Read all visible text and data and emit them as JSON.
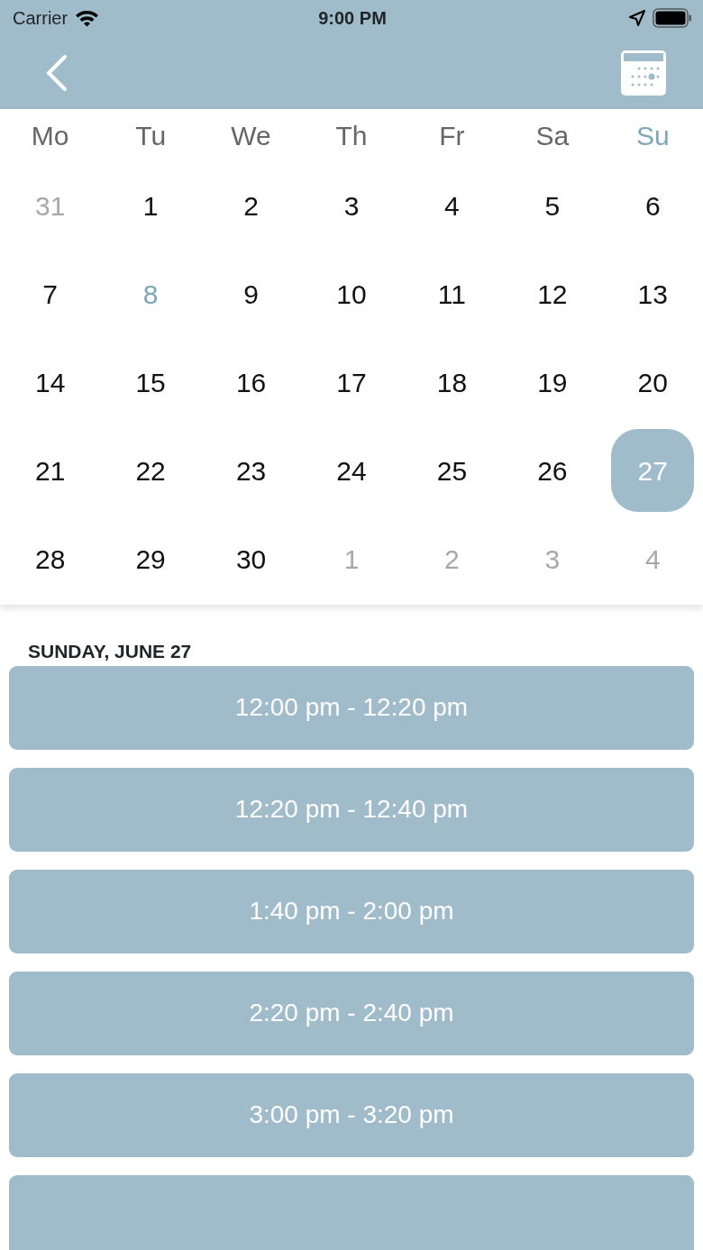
{
  "status_bar": {
    "carrier": "Carrier",
    "time": "9:00 PM"
  },
  "weekdays": [
    {
      "label": "Mo",
      "highlighted": false
    },
    {
      "label": "Tu",
      "highlighted": false
    },
    {
      "label": "We",
      "highlighted": false
    },
    {
      "label": "Th",
      "highlighted": false
    },
    {
      "label": "Fr",
      "highlighted": false
    },
    {
      "label": "Sa",
      "highlighted": false
    },
    {
      "label": "Su",
      "highlighted": true
    }
  ],
  "weeks": [
    [
      {
        "day": "31",
        "muted": true,
        "today": false,
        "selected": false
      },
      {
        "day": "1",
        "muted": false,
        "today": false,
        "selected": false
      },
      {
        "day": "2",
        "muted": false,
        "today": false,
        "selected": false
      },
      {
        "day": "3",
        "muted": false,
        "today": false,
        "selected": false
      },
      {
        "day": "4",
        "muted": false,
        "today": false,
        "selected": false
      },
      {
        "day": "5",
        "muted": false,
        "today": false,
        "selected": false
      },
      {
        "day": "6",
        "muted": false,
        "today": false,
        "selected": false
      }
    ],
    [
      {
        "day": "7",
        "muted": false,
        "today": false,
        "selected": false
      },
      {
        "day": "8",
        "muted": false,
        "today": true,
        "selected": false
      },
      {
        "day": "9",
        "muted": false,
        "today": false,
        "selected": false
      },
      {
        "day": "10",
        "muted": false,
        "today": false,
        "selected": false
      },
      {
        "day": "11",
        "muted": false,
        "today": false,
        "selected": false
      },
      {
        "day": "12",
        "muted": false,
        "today": false,
        "selected": false
      },
      {
        "day": "13",
        "muted": false,
        "today": false,
        "selected": false
      }
    ],
    [
      {
        "day": "14",
        "muted": false,
        "today": false,
        "selected": false
      },
      {
        "day": "15",
        "muted": false,
        "today": false,
        "selected": false
      },
      {
        "day": "16",
        "muted": false,
        "today": false,
        "selected": false
      },
      {
        "day": "17",
        "muted": false,
        "today": false,
        "selected": false
      },
      {
        "day": "18",
        "muted": false,
        "today": false,
        "selected": false
      },
      {
        "day": "19",
        "muted": false,
        "today": false,
        "selected": false
      },
      {
        "day": "20",
        "muted": false,
        "today": false,
        "selected": false
      }
    ],
    [
      {
        "day": "21",
        "muted": false,
        "today": false,
        "selected": false
      },
      {
        "day": "22",
        "muted": false,
        "today": false,
        "selected": false
      },
      {
        "day": "23",
        "muted": false,
        "today": false,
        "selected": false
      },
      {
        "day": "24",
        "muted": false,
        "today": false,
        "selected": false
      },
      {
        "day": "25",
        "muted": false,
        "today": false,
        "selected": false
      },
      {
        "day": "26",
        "muted": false,
        "today": false,
        "selected": false
      },
      {
        "day": "27",
        "muted": false,
        "today": false,
        "selected": true
      }
    ],
    [
      {
        "day": "28",
        "muted": false,
        "today": false,
        "selected": false
      },
      {
        "day": "29",
        "muted": false,
        "today": false,
        "selected": false
      },
      {
        "day": "30",
        "muted": false,
        "today": false,
        "selected": false
      },
      {
        "day": "1",
        "muted": true,
        "today": false,
        "selected": false
      },
      {
        "day": "2",
        "muted": true,
        "today": false,
        "selected": false
      },
      {
        "day": "3",
        "muted": true,
        "today": false,
        "selected": false
      },
      {
        "day": "4",
        "muted": true,
        "today": false,
        "selected": false
      }
    ]
  ],
  "date_heading": "SUNDAY, JUNE 27",
  "slots": [
    {
      "kind": "slot",
      "label": "12:00 pm - 12:20 pm"
    },
    {
      "kind": "slot",
      "label": "12:20 pm - 12:40 pm"
    },
    {
      "kind": "slot",
      "label": "1:40 pm - 2:00 pm"
    },
    {
      "kind": "slot",
      "label": "2:20 pm - 2:40 pm"
    },
    {
      "kind": "slot",
      "label": "3:00 pm - 3:20 pm"
    },
    {
      "kind": "cut"
    }
  ]
}
